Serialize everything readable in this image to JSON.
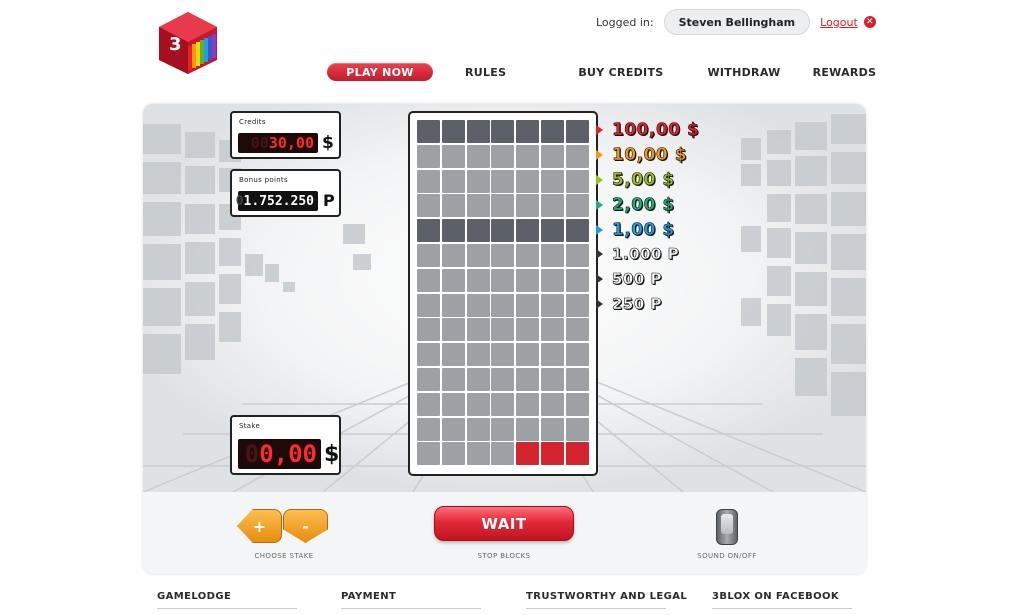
{
  "logo": {
    "name": "3blox-logo-icon"
  },
  "header": {
    "logged_in_label": "Logged in:",
    "user_name": "Steven Bellingham",
    "logout_label": "Logout",
    "logout_icon": "close-circle-icon"
  },
  "nav": {
    "items": [
      {
        "label": "PLAY NOW",
        "active": true
      },
      {
        "label": "RULES"
      },
      {
        "label": "BUY CREDITS"
      },
      {
        "label": "WITHDRAW"
      },
      {
        "label": "REWARDS"
      }
    ]
  },
  "game": {
    "credits": {
      "label": "Credits",
      "ghost": "00",
      "value": "30,00",
      "unit": "$"
    },
    "bonus": {
      "label": "Bonus points",
      "ghost": "0",
      "value": "1.752.250",
      "unit": "P"
    },
    "stake": {
      "label": "Stake",
      "ghost": "0",
      "value": "0,00",
      "unit": "$"
    },
    "board": {
      "columns": 7,
      "rows": 14,
      "dark_rows": [
        0,
        4
      ],
      "red_cells": [
        [
          13,
          4
        ],
        [
          13,
          5
        ],
        [
          13,
          6
        ]
      ]
    },
    "prizes": [
      {
        "label": "100,00 $",
        "color": "#e8202a",
        "arrow_color": "#e8202a"
      },
      {
        "label": "10,00 $",
        "color": "#f39a12",
        "arrow_color": "#f39a12"
      },
      {
        "label": "5,00 $",
        "color": "#9ac21a",
        "arrow_color": "#9ac21a"
      },
      {
        "label": "2,00 $",
        "color": "#1fae7a",
        "arrow_color": "#1fae7a"
      },
      {
        "label": "1,00 $",
        "color": "#1f9fe0",
        "arrow_color": "#1f9fe0"
      },
      {
        "label": "1.000 P",
        "color": "#ffffff",
        "arrow_color": "#333333"
      },
      {
        "label": "500 P",
        "color": "#ffffff",
        "arrow_color": "#333333"
      },
      {
        "label": "250 P",
        "color": "#ffffff",
        "arrow_color": "#333333"
      }
    ],
    "controls": {
      "plus_label": "+",
      "minus_label": "-",
      "choose_stake_label": "CHOOSE STAKE",
      "wait_label": "WAIT",
      "stop_blocks_label": "STOP BLOCKS",
      "sound_label": "SOUND ON/OFF"
    }
  },
  "footer": {
    "items": [
      "GAMELODGE",
      "PAYMENT",
      "TRUSTWORTHY AND LEGAL",
      "3BLOX ON FACEBOOK"
    ]
  }
}
